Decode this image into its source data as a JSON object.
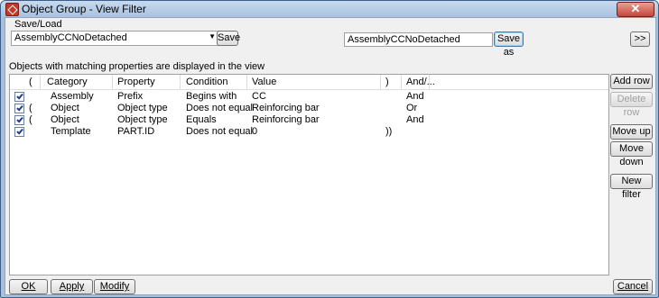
{
  "window": {
    "title": "Object Group - View Filter",
    "close_glyph": "✕"
  },
  "saveload": {
    "label": "Save/Load",
    "selected": "AssemblyCCNoDetached",
    "save_label": "Save",
    "saveas_value": "AssemblyCCNoDetached",
    "saveas_label": "Save as",
    "expand_label": ">>"
  },
  "info_text": "Objects with matching properties are displayed in the view",
  "table": {
    "headers": {
      "paren_open": "(",
      "category": "Category",
      "property": "Property",
      "condition": "Condition",
      "value": "Value",
      "paren_close": ")",
      "andor": "And/..."
    },
    "rows": [
      {
        "checked": true,
        "open": "",
        "category": "Assembly",
        "property": "Prefix",
        "condition": "Begins with",
        "value": "CC",
        "close": "",
        "andor": "And"
      },
      {
        "checked": true,
        "open": "(",
        "category": "Object",
        "property": "Object type",
        "condition": "Does not equal",
        "value": "Reinforcing bar",
        "close": "",
        "andor": "Or"
      },
      {
        "checked": true,
        "open": "(",
        "category": "Object",
        "property": "Object type",
        "condition": "Equals",
        "value": "Reinforcing bar",
        "close": "",
        "andor": "And"
      },
      {
        "checked": true,
        "open": "",
        "category": "Template",
        "property": "PART.ID",
        "condition": "Does not equal",
        "value": "0",
        "close": "))",
        "andor": ""
      }
    ]
  },
  "side_buttons": {
    "add_row": "Add row",
    "delete_row": "Delete row",
    "move_up": "Move up",
    "move_down": "Move down",
    "new_filter": "New filter"
  },
  "bottom_buttons": {
    "ok": "OK",
    "apply": "Apply",
    "modify": "Modify",
    "cancel": "Cancel"
  }
}
